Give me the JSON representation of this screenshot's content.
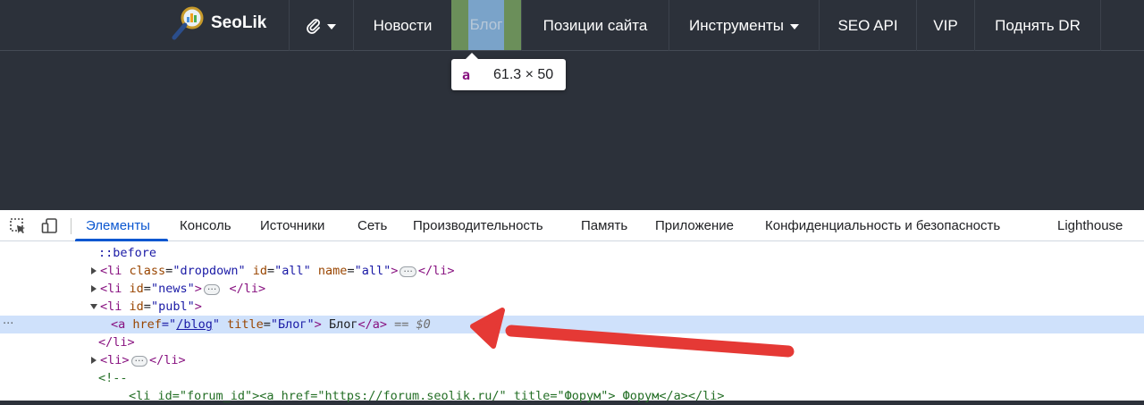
{
  "site": {
    "logo_text": "SeoLik",
    "nav": [
      {
        "label": "",
        "icon": "paperclip-icon",
        "dropdown": true
      },
      {
        "label": "Новости"
      },
      {
        "label": "Блог"
      },
      {
        "label": "Позиции сайта"
      },
      {
        "label": "Инструменты",
        "dropdown": true
      },
      {
        "label": "SEO API"
      },
      {
        "label": "VIP"
      },
      {
        "label": "Поднять DR"
      }
    ],
    "tooltip": {
      "tag": "a",
      "size": "61.3 × 50"
    }
  },
  "devtools": {
    "tabs": [
      "Элементы",
      "Консоль",
      "Источники",
      "Сеть",
      "Производительность",
      "Память",
      "Приложение",
      "Конфиденциальность и безопасность",
      "Lighthouse"
    ],
    "active_tab": "Элементы",
    "dom": {
      "before": "::before",
      "li_dropdown": {
        "open": "<li",
        "class_attr": "class",
        "class_val": "\"dropdown\"",
        "id_attr": "id",
        "id_val": "\"all\"",
        "name_attr": "name",
        "name_val": "\"all\"",
        "gt": ">",
        "close": "</li>"
      },
      "li_news": {
        "open": "<li",
        "id_attr": "id",
        "id_val": "\"news\"",
        "gt": ">",
        "close": "</li>"
      },
      "li_publ": {
        "open": "<li",
        "id_attr": "id",
        "id_val": "\"publ\"",
        "gt": ">"
      },
      "a_blog": {
        "open": "<a",
        "href_attr": "href",
        "eq": "=\"",
        "href_val": "/blog",
        "q": "\"",
        "title_attr": "title",
        "title_val": "\"Блог\"",
        "gt": ">",
        "text": " Блог",
        "close": "</a>",
        "eq_ref": " == ",
        "ref": "$0"
      },
      "li_close": "</li>",
      "li_empty": {
        "open": "<li>",
        "close": "</li>"
      },
      "comment_open": "<!--",
      "comment_line": "<li id=\"forum_id\"><a href=\"https://forum.seolik.ru/\" title=\"Форум\"> Форум</a></li>"
    }
  },
  "colors": {
    "accent": "#0b57d0",
    "arrow": "#e53935",
    "selected_row": "#cfe1fb"
  }
}
